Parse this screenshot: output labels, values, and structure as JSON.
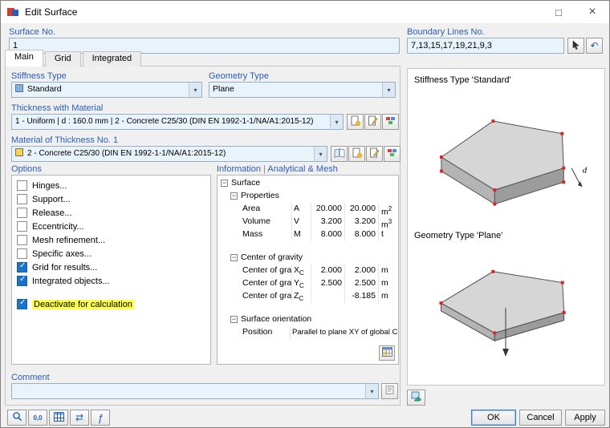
{
  "window": {
    "title": "Edit Surface"
  },
  "colors": {
    "label_blue": "#2a5db8",
    "field_background": "#e8f3fb",
    "highlight_yellow": "#ffff45",
    "checkbox_blue": "#1a73c9",
    "stiffness_swatch": "#7fb2e5",
    "material_swatch": "#ffd24d",
    "corner_marker_red": "#dd2222"
  },
  "icons": {
    "maximize": "□",
    "close": "×",
    "dropdown": "▾",
    "undo": "↶",
    "collapse": "−",
    "swap": "⇄",
    "function": "ƒ",
    "units": "0,0"
  },
  "header": {
    "surface_no": {
      "label": "Surface No.",
      "value": "1"
    },
    "boundary": {
      "label": "Boundary Lines No.",
      "value": "7,13,15,17,19,21,9,3"
    }
  },
  "tabs": {
    "main": "Main",
    "grid": "Grid",
    "integrated": "Integrated"
  },
  "fields": {
    "stiffness": {
      "label": "Stiffness Type",
      "value": "Standard"
    },
    "geometry": {
      "label": "Geometry Type",
      "value": "Plane"
    },
    "thickness": {
      "label": "Thickness with Material",
      "value": "1 - Uniform | d : 160.0 mm | 2 - Concrete C25/30 (DIN EN 1992-1-1/NA/A1:2015-12)"
    },
    "material": {
      "label": "Material of Thickness No. 1",
      "value": "2 - Concrete C25/30 (DIN EN 1992-1-1/NA/A1:2015-12)"
    }
  },
  "options": {
    "title": "Options",
    "items": {
      "hinges": {
        "label": "Hinges...",
        "checked": false
      },
      "support": {
        "label": "Support...",
        "checked": false
      },
      "release": {
        "label": "Release...",
        "checked": false
      },
      "eccentricity": {
        "label": "Eccentricity...",
        "checked": false
      },
      "mesh_refinement": {
        "label": "Mesh refinement...",
        "checked": false
      },
      "specific_axes": {
        "label": "Specific axes...",
        "checked": false
      },
      "grid_for_results": {
        "label": "Grid for results...",
        "checked": true
      },
      "integrated_objects": {
        "label": "Integrated objects...",
        "checked": true
      },
      "deactivate": {
        "label": "Deactivate for calculation",
        "checked": true,
        "highlighted": true
      }
    }
  },
  "information": {
    "header_left": "Information",
    "header_sep": "|",
    "header_right": "Analytical & Mesh",
    "root": "Surface",
    "groups": {
      "properties": "Properties",
      "cog": "Center of gravity",
      "orientation": "Surface orientation"
    },
    "rows": {
      "area": {
        "name": "Area",
        "sym": "A",
        "v1": "20.000",
        "v2": "20.000",
        "unit": "m",
        "sup": "2"
      },
      "volume": {
        "name": "Volume",
        "sym": "V",
        "v1": "3.200",
        "v2": "3.200",
        "unit": "m",
        "sup": "3"
      },
      "mass": {
        "name": "Mass",
        "sym": "M",
        "v1": "8.000",
        "v2": "8.000",
        "unit": "t"
      },
      "xc": {
        "name": "Center of gravity",
        "sym": "X",
        "sub": "C",
        "v1": "2.000",
        "v2": "2.000",
        "unit": "m"
      },
      "yc": {
        "name": "Center of gravity",
        "sym": "Y",
        "sub": "C",
        "v1": "2.500",
        "v2": "2.500",
        "unit": "m"
      },
      "zc": {
        "name": "Center of gravity",
        "sym": "Z",
        "sub": "C",
        "v1": "",
        "v2": "-8.185",
        "unit": "m"
      },
      "position": {
        "name": "Position",
        "value": "Parallel to plane XY of global CS"
      }
    }
  },
  "right_panel": {
    "stiffness_caption": "Stiffness Type 'Standard'",
    "geometry_caption": "Geometry Type 'Plane'",
    "dim_label": "d"
  },
  "comment": {
    "label": "Comment",
    "value": ""
  },
  "footer": {
    "ok": "OK",
    "cancel": "Cancel",
    "apply": "Apply"
  }
}
